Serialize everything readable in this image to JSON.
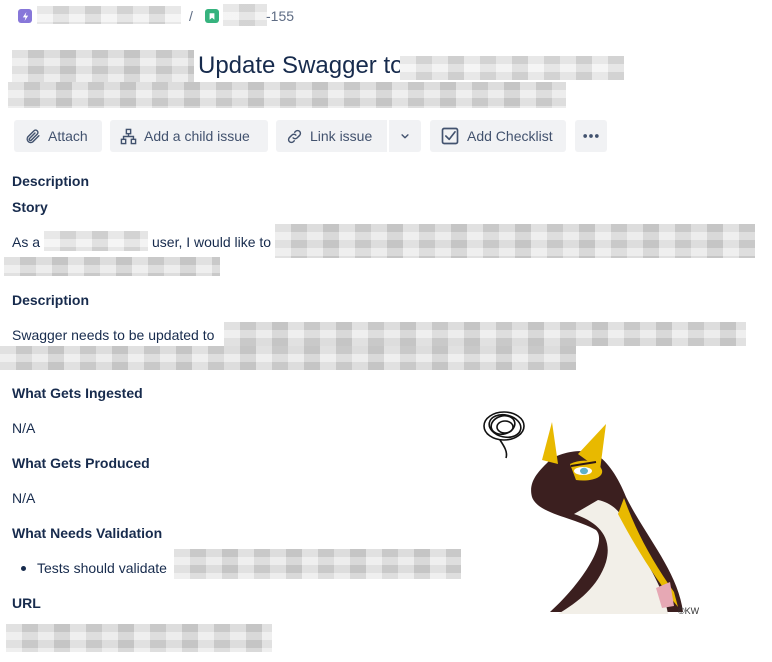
{
  "breadcrumb": {
    "issue_suffix": "-155",
    "separator": "/",
    "project_icon_color": "#8777d9",
    "issue_icon_color": "#36b37e"
  },
  "issue": {
    "title": "Update Swagger to"
  },
  "toolbar": {
    "attach_label": "Attach",
    "add_child_label": "Add a child issue",
    "link_issue_label": "Link issue",
    "add_checklist_label": "Add Checklist"
  },
  "description": {
    "heading": "Description",
    "story_heading": "Story",
    "story_prefix": "As a",
    "story_middle": "user, I would like to",
    "desc_heading": "Description",
    "desc_text": "Swagger needs to be updated to",
    "ingested_heading": "What Gets Ingested",
    "ingested_value": "N/A",
    "produced_heading": "What Gets Produced",
    "produced_value": "N/A",
    "validation_heading": "What Needs Validation",
    "validation_item": "Tests should validate",
    "url_heading": "URL"
  },
  "illustration": {
    "signature": "©KW"
  }
}
